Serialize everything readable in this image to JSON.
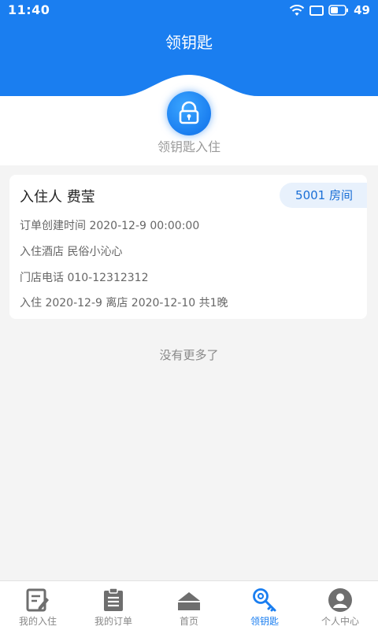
{
  "status_bar": {
    "time": "11:40",
    "battery": "49"
  },
  "header": {
    "title": "领钥匙"
  },
  "key_action": {
    "caption": "领钥匙入住",
    "icon": "lock-icon"
  },
  "booking": {
    "guest_label": "入住人 费莹",
    "room_badge": "5001 房间",
    "created": "订单创建时间 2020-12-9 00:00:00",
    "hotel": "入住酒店 民俗小沁心",
    "phone": "门店电话 010-12312312",
    "stay": "入住 2020-12-9 离店 2020-12-10 共1晚"
  },
  "list_footer": "没有更多了",
  "tabbar": {
    "tabs": [
      {
        "label": "我的入住",
        "icon": "edit-document-icon"
      },
      {
        "label": "我的订单",
        "icon": "clipboard-list-icon"
      },
      {
        "label": "首页",
        "icon": "home-icon"
      },
      {
        "label": "领钥匙",
        "icon": "key-icon"
      },
      {
        "label": "个人中心",
        "icon": "user-avatar-icon"
      }
    ],
    "active_index": 3
  },
  "colors": {
    "primary": "#1a7ef0",
    "badge_bg": "#e8f1fc",
    "background": "#f4f4f4"
  }
}
